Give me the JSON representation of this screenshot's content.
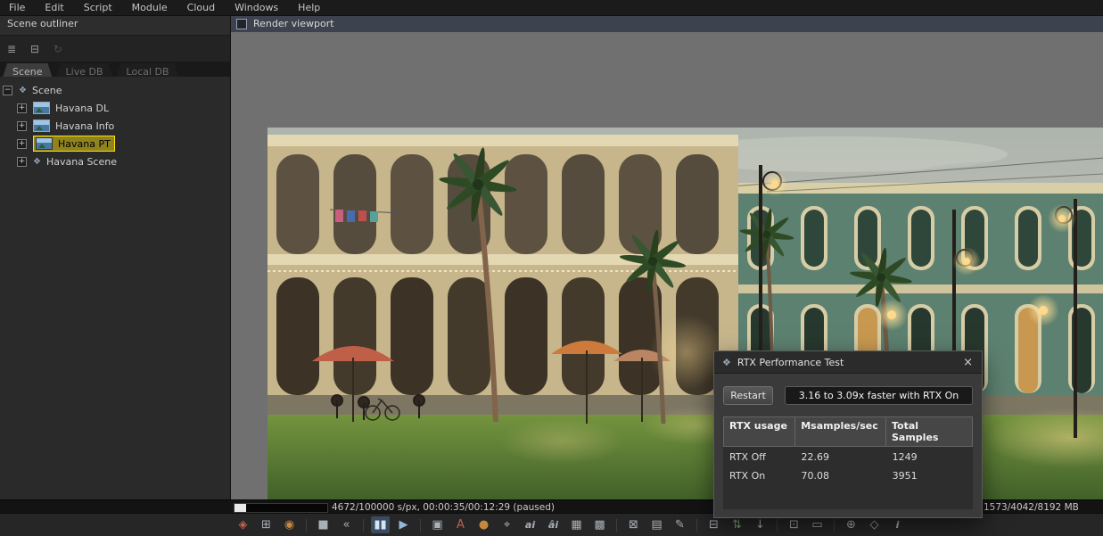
{
  "menubar": {
    "items": [
      "File",
      "Edit",
      "Script",
      "Module",
      "Cloud",
      "Windows",
      "Help"
    ]
  },
  "outliner": {
    "title": "Scene outliner",
    "toolbar": {
      "list_glyph": "≣",
      "collapse_glyph": "⊟",
      "refresh_glyph": "↻"
    },
    "tabs": {
      "scene": "Scene",
      "live": "Live DB",
      "local": "Local DB"
    },
    "tree": {
      "root": {
        "expander": "−",
        "icon": "❖",
        "label": "Scene"
      },
      "items": [
        {
          "expander": "+",
          "label": "Havana DL"
        },
        {
          "expander": "+",
          "label": "Havana Info"
        },
        {
          "expander": "+",
          "label": "Havana PT"
        },
        {
          "expander": "+",
          "icon": "❖",
          "label": "Havana Scene"
        }
      ]
    }
  },
  "viewport": {
    "header_label": "Render viewport"
  },
  "render_dialog": {
    "title": "RTX Performance Test",
    "icon": "❖",
    "close": "×",
    "restart": "Restart",
    "result": "3.16 to 3.09x faster with RTX On",
    "table": {
      "headers": [
        "RTX usage",
        "Msamples/sec",
        "Total Samples"
      ],
      "rows": [
        {
          "usage": "RTX Off",
          "msamples": "22.69",
          "total": "1249"
        },
        {
          "usage": "RTX On",
          "msamples": "70.08",
          "total": "3951"
        }
      ]
    }
  },
  "statusbar": {
    "progress_text": "4672/100000 s/px, 00:00:35/00:12:29 (paused)",
    "memory_text": "1573/4042/8192 MB"
  },
  "toolbar": {
    "icons": [
      {
        "name": "node-editor-icon",
        "glyph": "◈"
      },
      {
        "name": "recenter-view-icon",
        "glyph": "⊞"
      },
      {
        "name": "material-ball-icon",
        "glyph": "◉"
      },
      {
        "name": "stop-render-icon",
        "glyph": "■"
      },
      {
        "name": "restart-render-icon",
        "glyph": "«"
      },
      {
        "name": "pause-render-icon",
        "glyph": "▮▮"
      },
      {
        "name": "play-render-icon",
        "glyph": "▶"
      },
      {
        "name": "realtime-mode-icon",
        "glyph": "▣"
      },
      {
        "name": "text-overlay-icon",
        "glyph": "A"
      },
      {
        "name": "white-balance-icon",
        "glyph": "●"
      },
      {
        "name": "color-picker-icon",
        "glyph": "⌖"
      },
      {
        "name": "ai-denoiser-icon",
        "glyph": "ai"
      },
      {
        "name": "ai-upsampler-icon",
        "glyph": "âi"
      },
      {
        "name": "subsampling-icon",
        "glyph": "▦"
      },
      {
        "name": "alpha-mode-icon",
        "glyph": "▩"
      },
      {
        "name": "lock-resolution-icon",
        "glyph": "⊠"
      },
      {
        "name": "background-toggle-icon",
        "glyph": "▤"
      },
      {
        "name": "annotate-icon",
        "glyph": "✎"
      },
      {
        "name": "copy-image-icon",
        "glyph": "⊟"
      },
      {
        "name": "compare-ab-icon",
        "glyph": "⇅"
      },
      {
        "name": "save-image-icon",
        "glyph": "↓"
      },
      {
        "name": "render-region-icon",
        "glyph": "⊡"
      },
      {
        "name": "film-region-icon",
        "glyph": "▭"
      },
      {
        "name": "zoom-actual-icon",
        "glyph": "⊕"
      },
      {
        "name": "pan-view-icon",
        "glyph": "◇"
      },
      {
        "name": "viewport-info-icon",
        "glyph": "i"
      }
    ]
  }
}
